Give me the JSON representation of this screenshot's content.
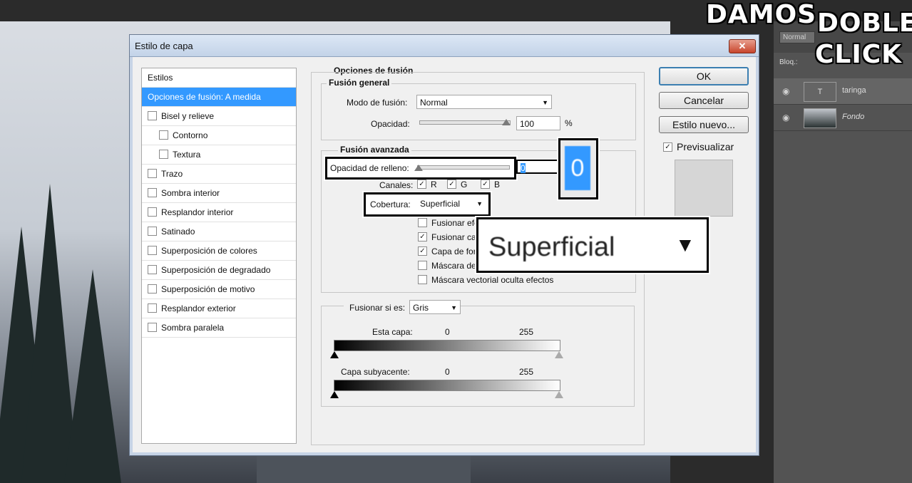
{
  "headline": {
    "line1": "DAMOS",
    "line2": "DOBLE",
    "line3": "CLICK"
  },
  "layers_panel": {
    "blend_mode": "Normal",
    "lock_label": "Bloq.:",
    "layers": [
      {
        "name": "taringa",
        "type": "text",
        "thumb_glyph": "T"
      },
      {
        "name": "Fondo",
        "type": "image"
      }
    ]
  },
  "dialog": {
    "title": "Estilo de capa",
    "close_glyph": "✕",
    "styles_header": "Estilos",
    "styles": [
      {
        "label": "Opciones de fusión: A medida",
        "checkbox": false,
        "selected": true,
        "indent": 0
      },
      {
        "label": "Bisel y relieve",
        "checkbox": true,
        "indent": 0
      },
      {
        "label": "Contorno",
        "checkbox": true,
        "indent": 1
      },
      {
        "label": "Textura",
        "checkbox": true,
        "indent": 1
      },
      {
        "label": "Trazo",
        "checkbox": true,
        "indent": 0
      },
      {
        "label": "Sombra interior",
        "checkbox": true,
        "indent": 0
      },
      {
        "label": "Resplandor interior",
        "checkbox": true,
        "indent": 0
      },
      {
        "label": "Satinado",
        "checkbox": true,
        "indent": 0
      },
      {
        "label": "Superposición de colores",
        "checkbox": true,
        "indent": 0
      },
      {
        "label": "Superposición de degradado",
        "checkbox": true,
        "indent": 0
      },
      {
        "label": "Superposición de motivo",
        "checkbox": true,
        "indent": 0
      },
      {
        "label": "Resplandor exterior",
        "checkbox": true,
        "indent": 0
      },
      {
        "label": "Sombra paralela",
        "checkbox": true,
        "indent": 0
      }
    ],
    "blend_options_title": "Opciones de fusión",
    "general": {
      "legend": "Fusión general",
      "mode_label": "Modo de fusión:",
      "mode_value": "Normal",
      "opacity_label": "Opacidad:",
      "opacity_value": "100",
      "opacity_unit": "%"
    },
    "advanced": {
      "legend": "Fusión avanzada",
      "fill_label": "Opacidad de relleno:",
      "fill_value": "0",
      "channels_label": "Canales:",
      "channels": [
        "R",
        "G",
        "B"
      ],
      "knockout_label": "Cobertura:",
      "knockout_value": "Superficial",
      "options": [
        {
          "label": "Fusionar efe",
          "checked": false
        },
        {
          "label": "Fusionar cap",
          "checked": true
        },
        {
          "label": "Capa de for",
          "checked": true
        },
        {
          "label": "Máscara de c",
          "checked": false
        },
        {
          "label": "Máscara vectorial oculta efectos",
          "checked": false
        }
      ]
    },
    "blend_if": {
      "label": "Fusionar si es:",
      "value": "Gris",
      "this_layer_label": "Esta capa:",
      "this_min": "0",
      "this_max": "255",
      "under_layer_label": "Capa subyacente:",
      "under_min": "0",
      "under_max": "255"
    },
    "buttons": {
      "ok": "OK",
      "cancel": "Cancelar",
      "new_style": "Estilo nuevo..."
    },
    "preview_label": "Previsualizar",
    "preview_checked": true
  },
  "zoom_callout": {
    "value": "Superficial",
    "arrow": "▼",
    "fill_zoom": "0"
  },
  "colors": {
    "accent": "#3399ff",
    "callout_border": "#000000"
  }
}
